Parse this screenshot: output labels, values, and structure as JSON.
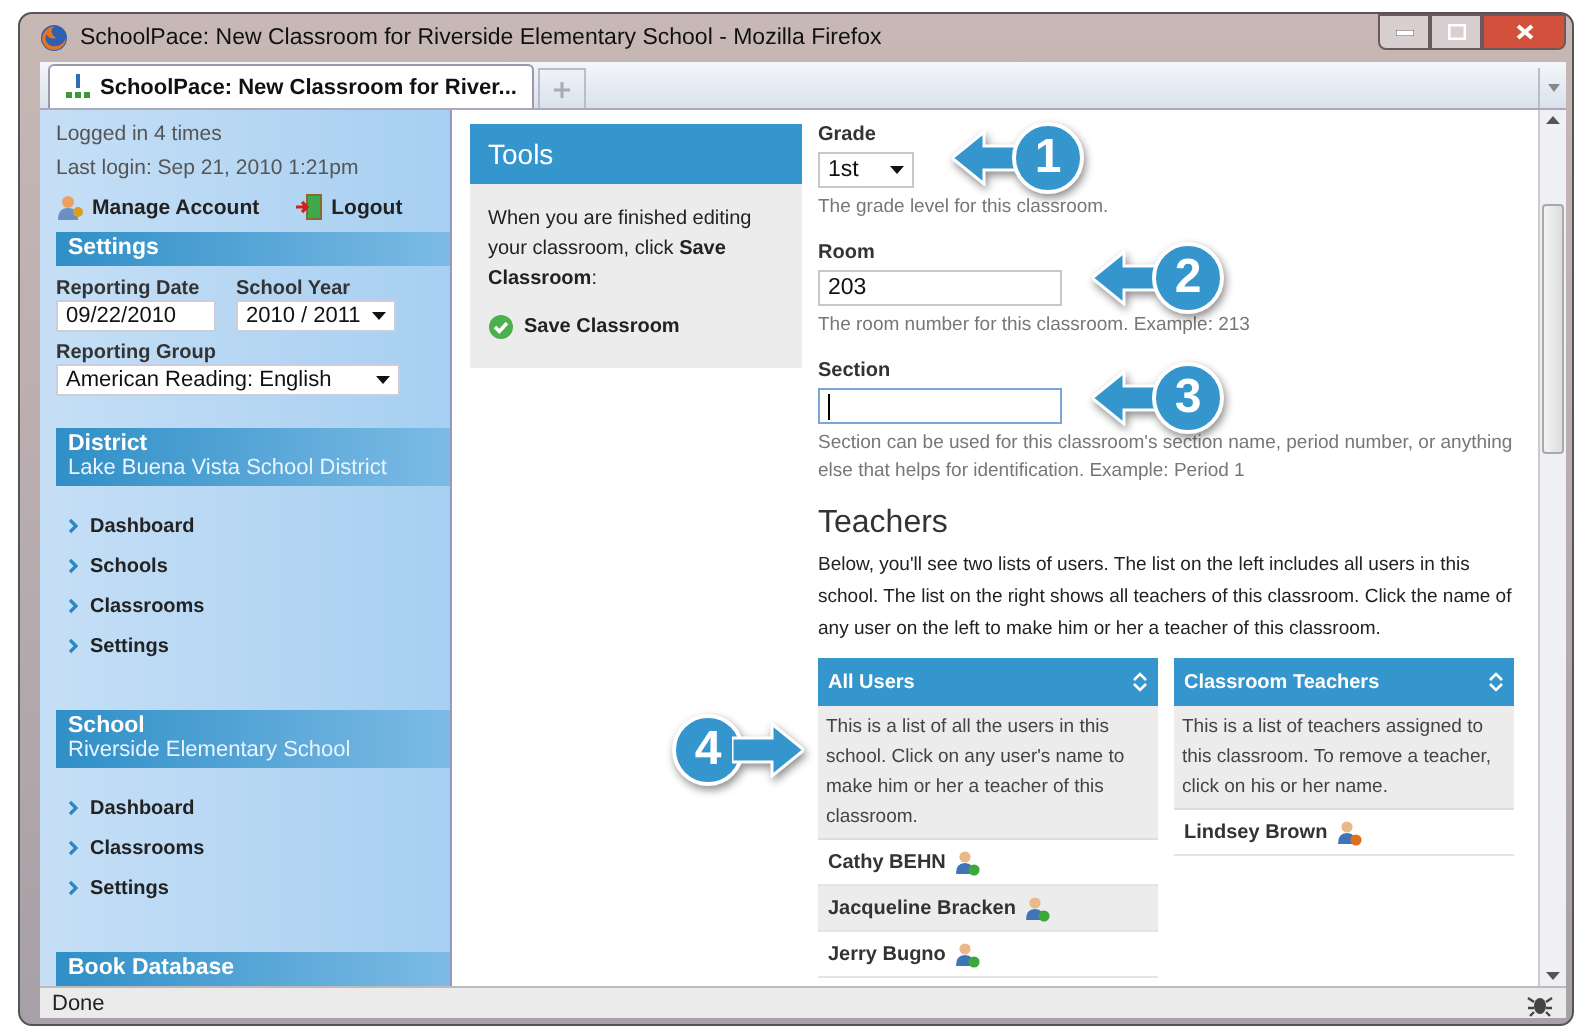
{
  "window": {
    "title": "SchoolPace: New Classroom for Riverside Elementary School - Mozilla Firefox"
  },
  "tabs": [
    {
      "label": "SchoolPace: New Classroom for River...",
      "selected": true
    }
  ],
  "sidebar": {
    "login_count": "Logged in 4 times",
    "last_login": "Last login: Sep 21, 2010 1:21pm",
    "account_links": [
      {
        "label": "Manage Account",
        "kind": "account"
      },
      {
        "label": "Logout",
        "kind": "logout"
      }
    ],
    "settings": {
      "title": "Settings",
      "fields": [
        {
          "label": "Reporting Date",
          "value": "09/22/2010",
          "kind": "text"
        },
        {
          "label": "School Year",
          "value": "2010 / 2011",
          "kind": "select"
        },
        {
          "label": "Reporting Group",
          "value": "American Reading: English",
          "kind": "select"
        }
      ]
    },
    "sections": [
      {
        "title": "District",
        "subtitle": "Lake Buena Vista School District",
        "items": [
          "Dashboard",
          "Schools",
          "Classrooms",
          "Settings"
        ]
      },
      {
        "title": "School",
        "subtitle": "Riverside Elementary School",
        "items": [
          "Dashboard",
          "Classrooms",
          "Settings"
        ]
      },
      {
        "title": "Book Database"
      }
    ]
  },
  "tools": {
    "title": "Tools",
    "message": "When you are finished editing your classroom, click **Save Classroom**:",
    "action": "Save Classroom"
  },
  "form": [
    {
      "label": "Grade",
      "kind": "select",
      "value": "1st",
      "hint": "The grade level for this classroom."
    },
    {
      "label": "Room",
      "kind": "text",
      "value": "203",
      "hint": "The room number for this classroom. Example: 213"
    },
    {
      "label": "Section",
      "kind": "text",
      "focused": true,
      "hint": "Section can be used for this classroom's section name, period number, or anything else that helps for identification. Example: Period 1"
    }
  ],
  "teachers": {
    "title": "Teachers",
    "intro": "Below, you'll see two lists of users. The list on the left includes all users in this school. The list on the right shows all teachers of this classroom. Click the name of any user on the left to make him or her a teacher of this classroom.",
    "lists": [
      {
        "title": "All Users",
        "kind": "add",
        "description": "This is a list of all the users in this school. Click on any user's name to make him or her a teacher of this classroom.",
        "users": [
          "Cathy BEHN",
          "Jacqueline Bracken",
          "Jerry Bugno"
        ]
      },
      {
        "title": "Classroom Teachers",
        "kind": "remove",
        "description": "This is a list of teachers assigned to this classroom. To remove a teacher, click on his or her name.",
        "users": [
          "Lindsey Brown"
        ]
      }
    ]
  },
  "callouts": [
    {
      "label": "1",
      "kind": "left"
    },
    {
      "label": "2",
      "kind": "left"
    },
    {
      "label": "3",
      "kind": "left"
    },
    {
      "label": "4",
      "kind": "right"
    }
  ],
  "status_bar": {
    "text": "Done"
  }
}
